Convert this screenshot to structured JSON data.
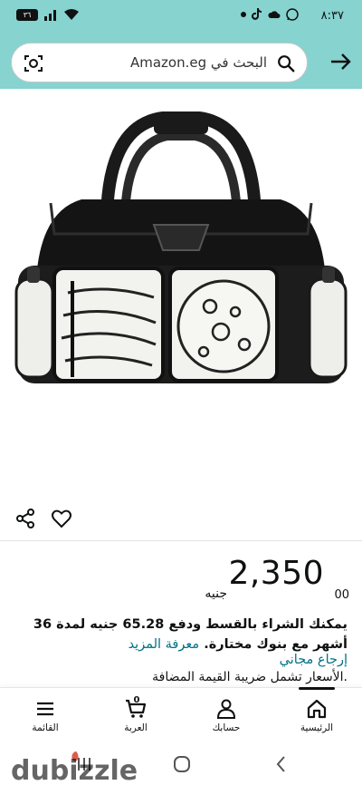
{
  "status_bar": {
    "time": "٨:٣٧",
    "battery": "٣٦",
    "icons": [
      "whatsapp-icon",
      "tiktok-icon",
      "dot-icon",
      "signal-icon",
      "wifi-icon",
      "battery-icon"
    ]
  },
  "header": {
    "search_placeholder": "البحث في Amazon.eg",
    "back_icon": "arrow-right-icon",
    "camera_icon": "camera-scan-icon"
  },
  "product": {
    "image_alt_icon": "duffel-bag-image"
  },
  "actions": {
    "share_icon": "share-icon",
    "wishlist_icon": "heart-icon"
  },
  "price": {
    "currency": "جنيه",
    "whole": "2,350",
    "fraction": "00"
  },
  "installment": {
    "text": "يمكنك الشراء بالقسط ودفع 65.28 جنيه لمدة 36 أشهر مع بنوك مختارة.",
    "learn_more": "معرفة المزيد"
  },
  "free_return": "إرجاع مجاني",
  "vat_note": ".الأسعار تشمل ضريبة القيمة المضافة",
  "bottom_nav": {
    "items": [
      {
        "label": "الرئيسية",
        "icon": "home-icon"
      },
      {
        "label": "حسابك",
        "icon": "user-icon"
      },
      {
        "label": "العربة",
        "icon": "cart-icon",
        "count": "0"
      },
      {
        "label": "القائمة",
        "icon": "menu-icon"
      }
    ]
  },
  "watermark": "dubizzle",
  "colors": {
    "header_bg": "#86d3d0",
    "link": "#007185",
    "text": "#0f1111",
    "watermark": "#d84a3a"
  }
}
